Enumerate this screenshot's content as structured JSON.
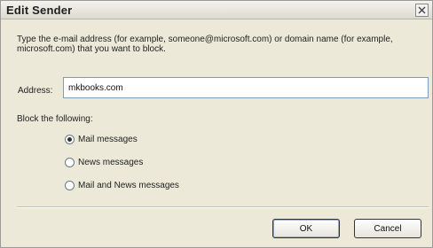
{
  "dialog": {
    "title": "Edit Sender",
    "instructions": "Type the e-mail address (for example, someone@microsoft.com) or domain name (for example, microsoft.com) that you want to block.",
    "address_label": "Address:",
    "address_value": "mkbooks.com",
    "block_label": "Block the following:",
    "options": [
      {
        "label": "Mail messages",
        "checked": true
      },
      {
        "label": "News messages",
        "checked": false
      },
      {
        "label": "Mail and News messages",
        "checked": false
      }
    ],
    "ok_label": "OK",
    "cancel_label": "Cancel",
    "close_icon": "close-icon"
  }
}
